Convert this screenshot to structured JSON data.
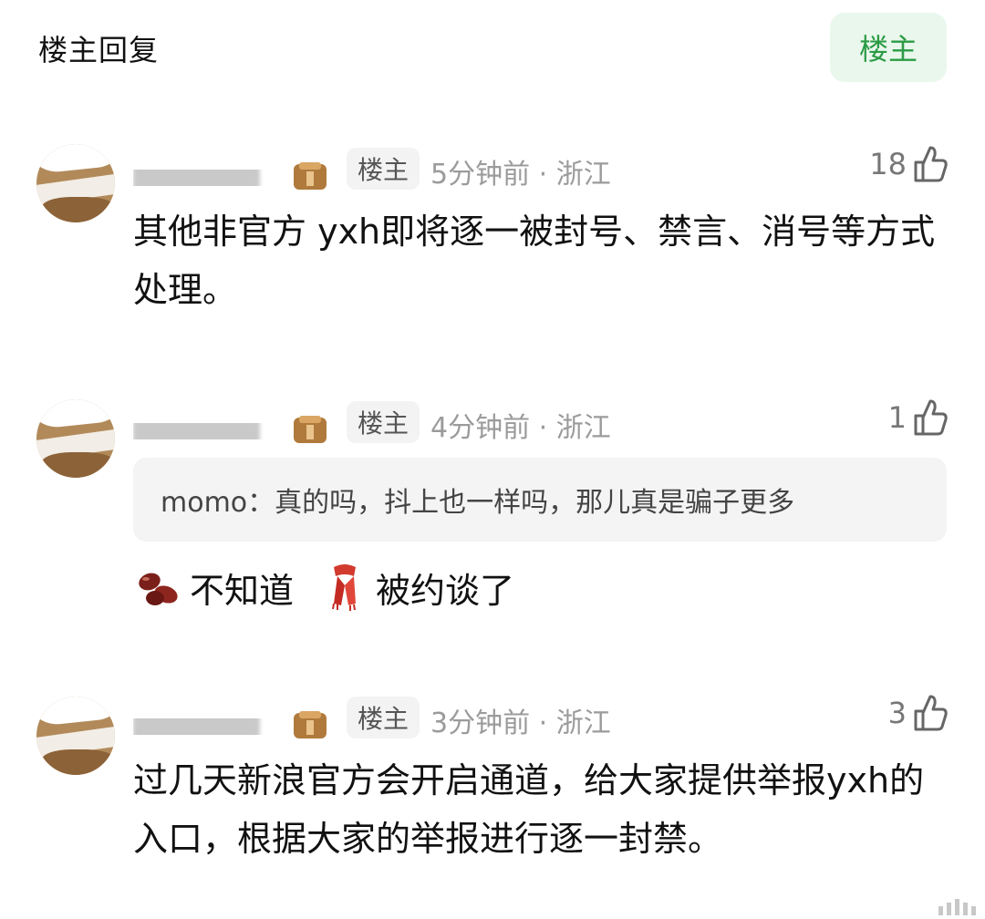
{
  "header": {
    "title": "楼主回复",
    "tab_label": "楼主"
  },
  "comments": [
    {
      "owner_badge": "楼主",
      "meta": "5分钟前 · 浙江",
      "likes": "18",
      "text": "其他非官方 yxh即将逐一被封号、禁言、消号等方式处理。"
    },
    {
      "owner_badge": "楼主",
      "meta": "4分钟前 · 浙江",
      "likes": "1",
      "quote": "momo：真的吗，抖上也一样吗，那儿真是骗子更多",
      "reply_parts": [
        "不知道",
        "被约谈了"
      ],
      "emoji_icons": [
        "beans-icon",
        "scarf-icon"
      ]
    },
    {
      "owner_badge": "楼主",
      "meta": "3分钟前 · 浙江",
      "likes": "3",
      "text": "过几天新浪官方会开启通道，给大家提供举报yxh的入口，根据大家的举报进行逐一封禁。"
    }
  ],
  "colors": {
    "accent_green": "#2b9b45",
    "tab_bg": "#e9f7ec",
    "meta_gray": "#9b9b9b",
    "quote_bg": "#f4f4f4"
  }
}
